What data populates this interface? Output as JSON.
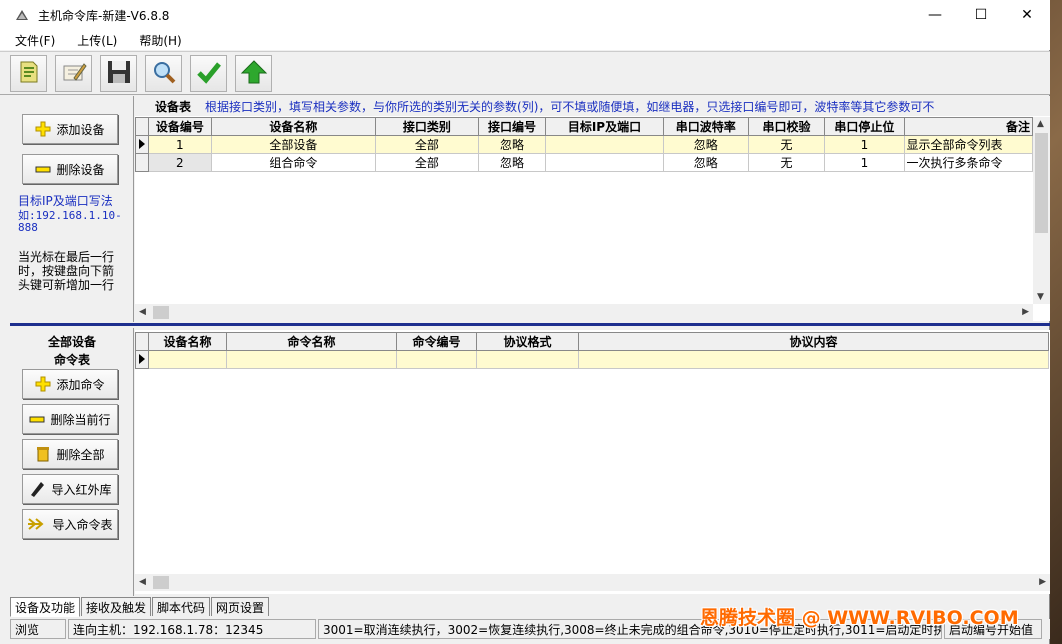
{
  "window": {
    "title": "主机命令库-新建-V6.8.8",
    "controls": {
      "minimize": "—",
      "maximize": "☐",
      "close": "✕"
    }
  },
  "menu": [
    "文件(F)",
    "上传(L)",
    "帮助(H)"
  ],
  "toolbar": {
    "buttons": [
      "new-icon",
      "edit-icon",
      "save-icon",
      "search-icon",
      "check-icon",
      "upload-arrow-icon"
    ]
  },
  "upper_left": {
    "add_device_label": "添加设备",
    "delete_device_label": "删除设备",
    "ip_hint_title": "目标IP及端口写法",
    "ip_hint_example": "如:192.168.1.10-888",
    "cursor_hint": "当光标在最后一行时，按键盘向下箭头键可新增加一行"
  },
  "device_table": {
    "caption": "设备表",
    "hint": "根据接口类别，填写相关参数，与你所选的类别无关的参数(列)，可不填或随便填，如继电器，只选接口编号即可，波特率等其它参数可不",
    "columns": [
      "设备编号",
      "设备名称",
      "接口类别",
      "接口编号",
      "目标IP及端口",
      "串口波特率",
      "串口校验",
      "串口停止位",
      "备注"
    ],
    "rows": [
      [
        "1",
        "全部设备",
        "全部",
        "忽略",
        "",
        "忽略",
        "无",
        "1",
        "显示全部命令列表"
      ],
      [
        "2",
        "组合命令",
        "全部",
        "忽略",
        "",
        "忽略",
        "无",
        "1",
        "一次执行多条命令"
      ]
    ]
  },
  "lower_left": {
    "title_line1": "全部设备",
    "title_line2": "命令表",
    "add_command_label": "添加命令",
    "delete_row_label": "删除当前行",
    "delete_all_label": "删除全部",
    "import_ir_label": "导入红外库",
    "import_table_label": "导入命令表"
  },
  "command_table": {
    "columns": [
      "设备名称",
      "命令名称",
      "命令编号",
      "协议格式",
      "协议内容"
    ]
  },
  "tabs": [
    "设备及功能",
    "接收及触发",
    "脚本代码",
    "网页设置"
  ],
  "statusbar": {
    "mode": "浏览",
    "connection": "连向主机：192.168.1.78：12345",
    "message": "3001=取消连续执行，3002=恢复连续执行,3008=终止未完成的组合命令,3010=停止定时执行,3011=启动定时执行",
    "right": "启动编号开始值"
  },
  "watermark": "恩腾技术圈 @ WWW.RVIBO.COM"
}
